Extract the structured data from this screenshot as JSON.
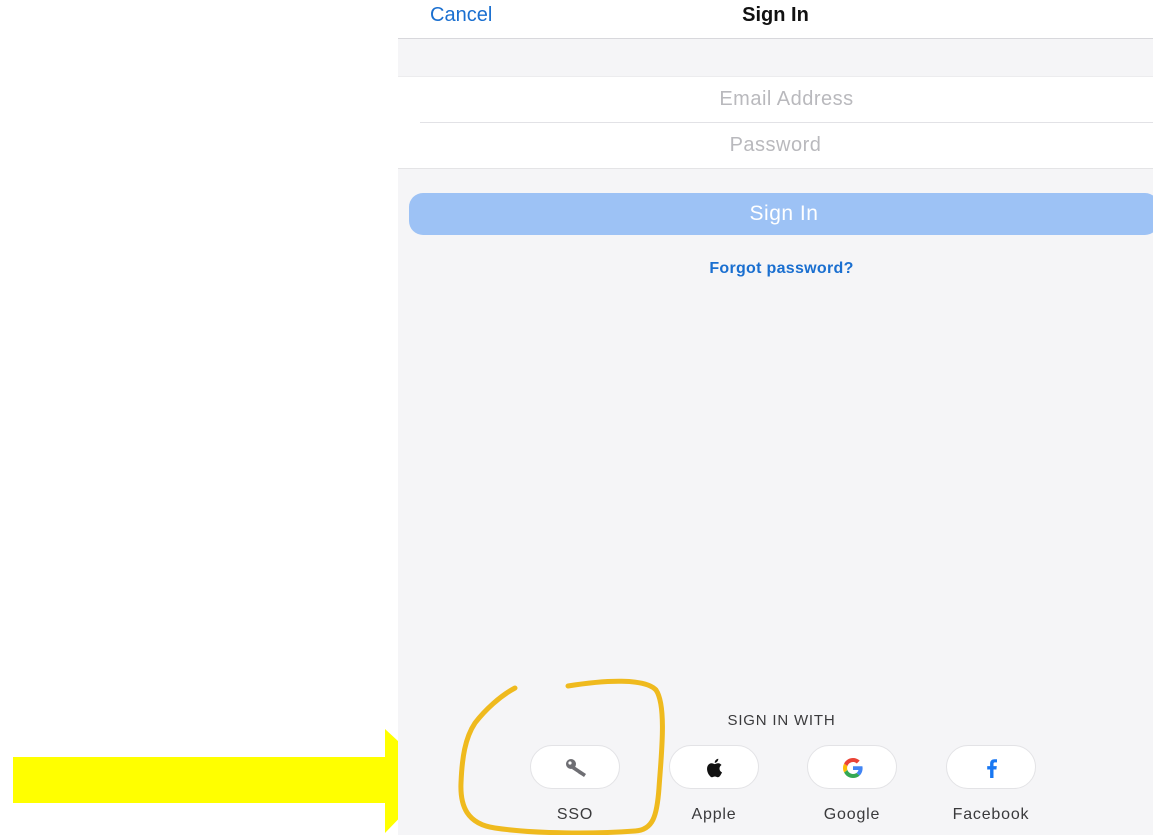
{
  "navbar": {
    "cancel_label": "Cancel",
    "title": "Sign In"
  },
  "form": {
    "email_placeholder": "Email Address",
    "password_placeholder": "Password"
  },
  "signin_button_label": "Sign In",
  "forgot_password_label": "Forgot password?",
  "sign_in_with": {
    "heading": "SIGN IN WITH",
    "providers": [
      {
        "label": "SSO",
        "icon": "key-icon"
      },
      {
        "label": "Apple",
        "icon": "apple-icon"
      },
      {
        "label": "Google",
        "icon": "google-icon"
      },
      {
        "label": "Facebook",
        "icon": "facebook-icon"
      }
    ]
  },
  "colors": {
    "link_blue": "#1a6fd0",
    "button_blue": "#9dc2f5",
    "annotation_yellow": "#ffff00",
    "circle_highlight": "#efba1e"
  }
}
